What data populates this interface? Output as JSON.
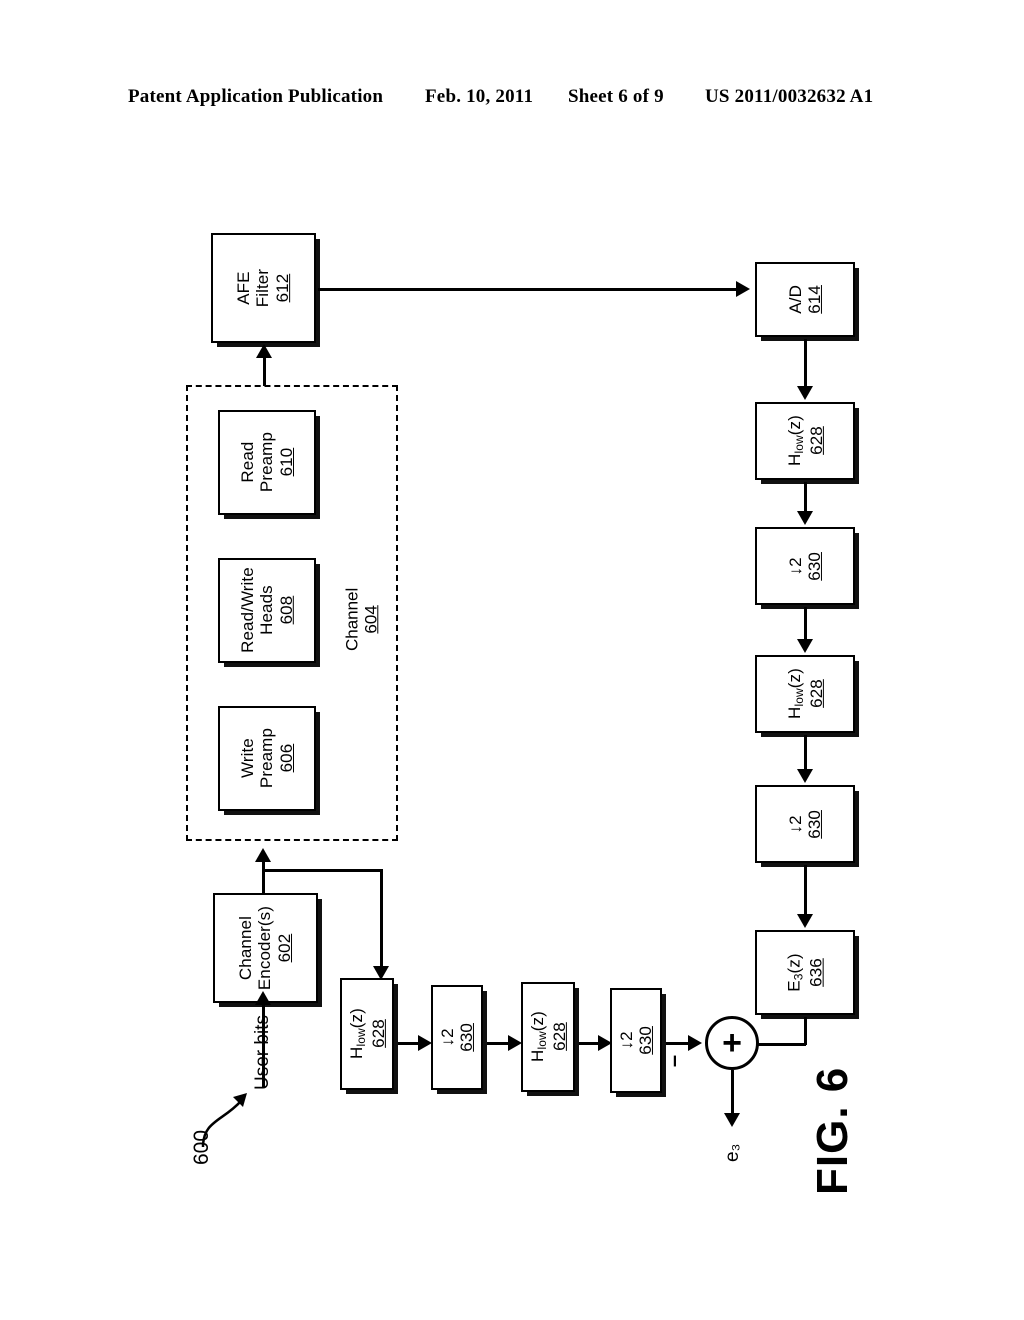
{
  "header": {
    "publication": "Patent Application Publication",
    "date": "Feb. 10, 2011",
    "sheet": "Sheet 6 of 9",
    "document_number": "US 2011/0032632 A1"
  },
  "figure": {
    "label": "FIG. 6",
    "system_ref": "600",
    "input_label": "User bits",
    "output_label": "e₃"
  },
  "blocks": {
    "afe_filter": {
      "line1": "AFE",
      "line2": "Filter",
      "ref": "612"
    },
    "ad_converter": {
      "line1": "A/D",
      "line2": "",
      "ref": "614"
    },
    "read_preamp": {
      "line1": "Read",
      "line2": "Preamp",
      "ref": "610"
    },
    "rw_heads": {
      "line1": "Read/Write",
      "line2": "Heads",
      "ref": "608"
    },
    "write_preamp": {
      "line1": "Write",
      "line2": "Preamp",
      "ref": "606"
    },
    "channel_encoder": {
      "line1": "Channel",
      "line2": "Encoder(s)",
      "ref": "602"
    },
    "channel_group": {
      "line1": "Channel",
      "line2": "",
      "ref": "604"
    },
    "hlow_r1": {
      "line1": "H",
      "sub": "low",
      "line2": "(z)",
      "ref": "628"
    },
    "dec2_r1": {
      "line1": "↓2",
      "line2": "",
      "ref": "630"
    },
    "hlow_r2": {
      "line1": "H",
      "sub": "low",
      "line2": "(z)",
      "ref": "628"
    },
    "dec2_r2": {
      "line1": "↓2",
      "line2": "",
      "ref": "630"
    },
    "e3z": {
      "line1": "E",
      "sub": "3",
      "line2": "(z)",
      "ref": "636"
    },
    "hlow_b1": {
      "line1": "H",
      "sub": "low",
      "line2": "(z)",
      "ref": "628"
    },
    "dec2_b1": {
      "line1": "↓2",
      "line2": "",
      "ref": "630"
    },
    "hlow_b2": {
      "line1": "H",
      "sub": "low",
      "line2": "(z)",
      "ref": "628"
    },
    "dec2_b2": {
      "line1": "↓2",
      "line2": "",
      "ref": "630"
    }
  },
  "summer": {
    "operator": "+",
    "negative_input_sign": "–"
  },
  "colors": {
    "ink": "#000000",
    "paper": "#ffffff"
  }
}
